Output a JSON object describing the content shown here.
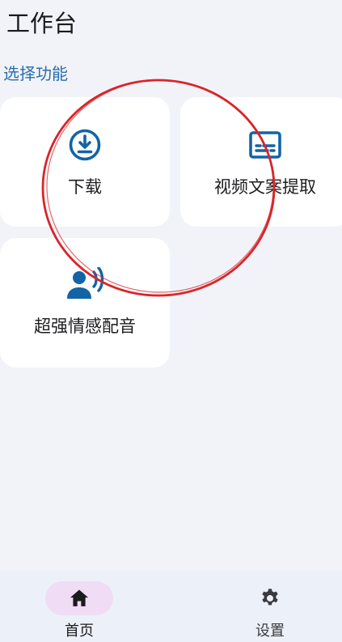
{
  "header": {
    "title": "工作台"
  },
  "section": {
    "title": "选择功能"
  },
  "cards": [
    {
      "label": "下载",
      "icon": "download-circle-icon"
    },
    {
      "label": "视频文案提取",
      "icon": "subtitles-icon"
    },
    {
      "label": "超强情感配音",
      "icon": "voice-user-icon"
    }
  ],
  "bottom_nav": {
    "items": [
      {
        "label": "首页",
        "icon": "home-icon",
        "selected": true
      },
      {
        "label": "设置",
        "icon": "gear-icon",
        "selected": false
      }
    ]
  },
  "colors": {
    "accent": "#2a6dae",
    "icon_blue": "#1264a6",
    "background": "#f2f3f8",
    "nav_selected_pill": "#f1dcf5",
    "annotation_red": "#d9252a"
  }
}
